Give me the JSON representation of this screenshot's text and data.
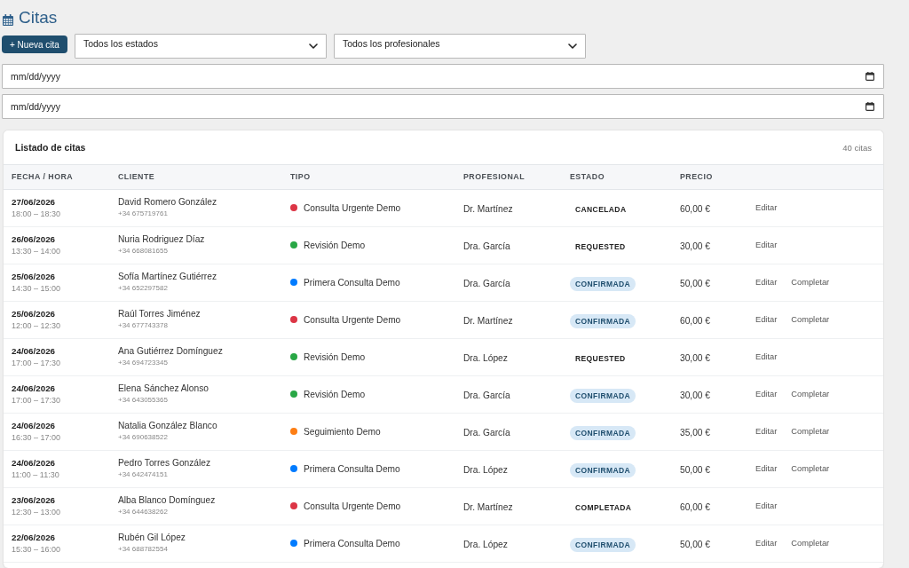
{
  "page": {
    "title": "Citas"
  },
  "toolbar": {
    "new_button": "+ Nueva cita",
    "status_filter": {
      "value": "Todos los estados"
    },
    "professional_filter": {
      "value": "Todos los profesionales"
    }
  },
  "date_from": {
    "placeholder": "mm/dd/yyyy"
  },
  "date_to": {
    "placeholder": "mm/dd/yyyy"
  },
  "list": {
    "title": "Listado de citas",
    "count": "40 citas",
    "columns": [
      "FECHA / HORA",
      "CLIENTE",
      "TIPO",
      "PROFESIONAL",
      "ESTADO",
      "PRECIO"
    ],
    "rows": [
      {
        "date": "27/06/2026",
        "time": "18:00 – 18:30",
        "client": "David Romero González",
        "phone": "+34 675719761",
        "type": {
          "label": "Consulta Urgente Demo",
          "color": "#dc3545"
        },
        "professional": "Dr. Martínez",
        "status": {
          "label": "CANCELADA",
          "kind": "plain"
        },
        "price": "60,00 €",
        "actions": [
          "Editar"
        ]
      },
      {
        "date": "26/06/2026",
        "time": "13:30 – 14:00",
        "client": "Nuria Rodriguez Díaz",
        "phone": "+34 668081655",
        "type": {
          "label": "Revisión Demo",
          "color": "#28a745"
        },
        "professional": "Dra. García",
        "status": {
          "label": "REQUESTED",
          "kind": "plain"
        },
        "price": "30,00 €",
        "actions": [
          "Editar"
        ]
      },
      {
        "date": "25/06/2026",
        "time": "14:30 – 15:00",
        "client": "Sofía Martínez Gutiérrez",
        "phone": "+34 652297582",
        "type": {
          "label": "Primera Consulta Demo",
          "color": "#007bff"
        },
        "professional": "Dra. García",
        "status": {
          "label": "CONFIRMADA",
          "kind": "pill"
        },
        "price": "50,00 €",
        "actions": [
          "Editar",
          "Completar"
        ]
      },
      {
        "date": "25/06/2026",
        "time": "12:00 – 12:30",
        "client": "Raúl Torres Jiménez",
        "phone": "+34 677743378",
        "type": {
          "label": "Consulta Urgente Demo",
          "color": "#dc3545"
        },
        "professional": "Dr. Martínez",
        "status": {
          "label": "CONFIRMADA",
          "kind": "pill"
        },
        "price": "60,00 €",
        "actions": [
          "Editar",
          "Completar"
        ]
      },
      {
        "date": "24/06/2026",
        "time": "17:00 – 17:30",
        "client": "Ana Gutiérrez Domínguez",
        "phone": "+34 694723345",
        "type": {
          "label": "Revisión Demo",
          "color": "#28a745"
        },
        "professional": "Dra. López",
        "status": {
          "label": "REQUESTED",
          "kind": "plain"
        },
        "price": "30,00 €",
        "actions": [
          "Editar"
        ]
      },
      {
        "date": "24/06/2026",
        "time": "17:00 – 17:30",
        "client": "Elena Sánchez Alonso",
        "phone": "+34 643055365",
        "type": {
          "label": "Revisión Demo",
          "color": "#28a745"
        },
        "professional": "Dra. García",
        "status": {
          "label": "CONFIRMADA",
          "kind": "pill"
        },
        "price": "30,00 €",
        "actions": [
          "Editar",
          "Completar"
        ]
      },
      {
        "date": "24/06/2026",
        "time": "16:30 – 17:00",
        "client": "Natalia González Blanco",
        "phone": "+34 690638522",
        "type": {
          "label": "Seguimiento Demo",
          "color": "#fd7e14"
        },
        "professional": "Dra. García",
        "status": {
          "label": "CONFIRMADA",
          "kind": "pill"
        },
        "price": "35,00 €",
        "actions": [
          "Editar",
          "Completar"
        ]
      },
      {
        "date": "24/06/2026",
        "time": "11:00 – 11:30",
        "client": "Pedro Torres González",
        "phone": "+34 642474151",
        "type": {
          "label": "Primera Consulta Demo",
          "color": "#007bff"
        },
        "professional": "Dra. López",
        "status": {
          "label": "CONFIRMADA",
          "kind": "pill"
        },
        "price": "50,00 €",
        "actions": [
          "Editar",
          "Completar"
        ]
      },
      {
        "date": "23/06/2026",
        "time": "12:30 – 13:00",
        "client": "Alba Blanco Domínguez",
        "phone": "+34 644638262",
        "type": {
          "label": "Consulta Urgente Demo",
          "color": "#dc3545"
        },
        "professional": "Dr. Martínez",
        "status": {
          "label": "COMPLETADA",
          "kind": "plain"
        },
        "price": "60,00 €",
        "actions": [
          "Editar"
        ]
      },
      {
        "date": "22/06/2026",
        "time": "15:30 – 16:00",
        "client": "Rubén Gil López",
        "phone": "+34 688782554",
        "type": {
          "label": "Primera Consulta Demo",
          "color": "#007bff"
        },
        "professional": "Dra. López",
        "status": {
          "label": "CONFIRMADA",
          "kind": "pill"
        },
        "price": "50,00 €",
        "actions": [
          "Editar",
          "Completar"
        ]
      }
    ]
  }
}
